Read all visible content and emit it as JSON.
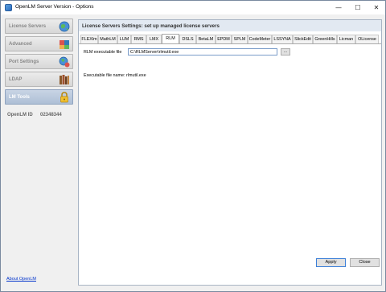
{
  "window": {
    "title": "OpenLM Server Version - Options"
  },
  "titlebar_buttons": {
    "minimize": "—",
    "maximize": "☐",
    "close": "✕"
  },
  "sidebar": {
    "items": [
      {
        "label": "License Servers",
        "icon": "globe-icon",
        "active": false
      },
      {
        "label": "Advanced",
        "icon": "advanced-icon",
        "active": false
      },
      {
        "label": "Port Settings",
        "icon": "globe-plug-icon",
        "active": false
      },
      {
        "label": "LDAP",
        "icon": "ldap-books-icon",
        "active": false
      },
      {
        "label": "LM Tools",
        "icon": "lock-icon",
        "active": true
      }
    ],
    "id_label": "OpenLM ID",
    "id_value": "02348344",
    "about_link": "About OpenLM"
  },
  "panel": {
    "title": "License Servers Settings: set up managed license servers",
    "tabs": [
      "FLEXlm",
      "MathLM",
      "LUM",
      "RMS",
      "LMX",
      "RLM",
      "DSLS",
      "BetaLM",
      "EPDM",
      "SPLM",
      "CodeMeter",
      "LSSYNA",
      "SlickEdit",
      "GreenHills",
      "Licman",
      "OLicense"
    ],
    "active_tab": "RLM",
    "rlm": {
      "exe_label": "RLM executable file",
      "exe_value": "C:\\RLMServer\\rlmutil.exe",
      "browse_label": "...",
      "exe_name_text": "Executable file name: rlmutil.exe"
    }
  },
  "footer": {
    "apply_label": "Apply",
    "close_label": "Close"
  },
  "colors": {
    "accent": "#3c7fd8",
    "active_nav": "#aebfd6",
    "link": "#0033cc"
  }
}
